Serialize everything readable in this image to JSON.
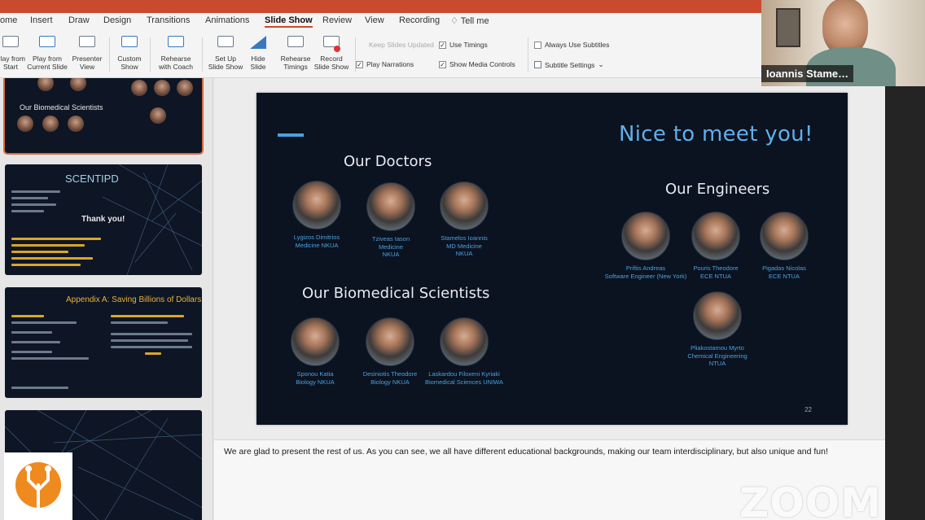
{
  "menu": [
    "ome",
    "Insert",
    "Draw",
    "Design",
    "Transitions",
    "Animations",
    "Slide Show",
    "Review",
    "View",
    "Recording",
    "Tell me"
  ],
  "ribbon": {
    "play_from_start": "Play from\nStart",
    "play_from_current": "Play from\nCurrent Slide",
    "presenter_view": "Presenter\nView",
    "custom_show": "Custom\nShow",
    "rehearse_coach": "Rehearse\nwith Coach",
    "set_up": "Set Up\nSlide Show",
    "hide_slide": "Hide\nSlide",
    "rehearse_timings": "Rehearse\nTimings",
    "record_slide_show": "Record\nSlide Show",
    "keep_slides_updated": "Keep Slides Updated",
    "use_timings": "Use Timings",
    "play_narrations": "Play Narrations",
    "show_media_controls": "Show Media Controls",
    "always_use_subtitles": "Always Use Subtitles",
    "subtitle_settings": "Subtitle Settings"
  },
  "thumbnails": {
    "t1_heading": "Our Biomedical Scientists",
    "t2_brand": "SCENTIPD",
    "t2_thanks": "Thank you!",
    "t3_title": "Appendix A: Saving Billions of Dollars"
  },
  "slide": {
    "title": "Nice to meet you!",
    "doctors_heading": "Our Doctors",
    "engineers_heading": "Our Engineers",
    "scientists_heading": "Our Biomedical Scientists",
    "page_number": "22",
    "doctors": [
      "Lygizos Dimitrios\nMedicine NKUA",
      "Tziveas Iason\nMedicine\nNKUA",
      "Stamelos Ioannis\nMD Medicine\nNKUA"
    ],
    "engineers": [
      "Priftis Andreas\nSoftware Engineer (New York)",
      "Pouris Theodore\nECE NTUA",
      "Pigadas Nicolas\nECE NTUA",
      "Pliakostamou Myrto\nChemical Engineering\nNTUA"
    ],
    "scientists": [
      "Sponou Katia\nBiology NKUA",
      "Desiniotis Theodore\nBiology NKUA",
      "Laskardou Filoxeni Kyriaki\nBiomedical Sciences UNIWA"
    ]
  },
  "notes": "We are glad to present the rest of us. As you can see, we all have different educational backgrounds, making our team interdisciplinary, but also unique and fun!",
  "video": {
    "participant_name": "Ioannis Stame…"
  },
  "watermark": "ZOOM"
}
